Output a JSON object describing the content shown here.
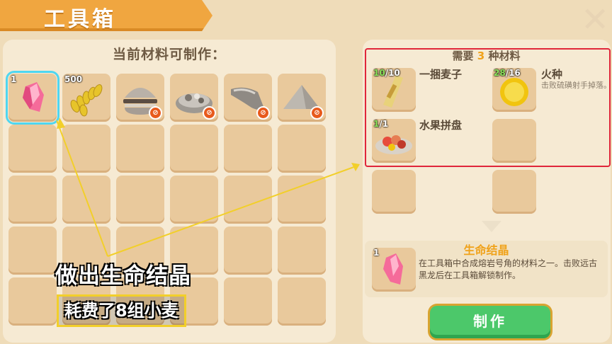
{
  "header": {
    "title": "工具箱"
  },
  "left": {
    "heading": "当前材料可制作：",
    "items": [
      {
        "name": "life-crystal",
        "count": "1",
        "selected": true,
        "locked": false
      },
      {
        "name": "wheat",
        "count": "500",
        "selected": false,
        "locked": false
      },
      {
        "name": "burger",
        "count": "",
        "selected": false,
        "locked": true
      },
      {
        "name": "food-platter",
        "count": "",
        "selected": false,
        "locked": true
      },
      {
        "name": "horn",
        "count": "",
        "selected": false,
        "locked": true
      },
      {
        "name": "powder-pile",
        "count": "",
        "selected": false,
        "locked": true
      }
    ]
  },
  "recipe": {
    "heading_prefix": "需要",
    "heading_count": "3",
    "heading_suffix": "种材料",
    "materials": [
      {
        "name": "一捆麦子",
        "have": "10",
        "need": "/10",
        "desc": ""
      },
      {
        "name": "火种",
        "have": "28",
        "need": "/16",
        "desc": "击败硫磺射手掉落。"
      },
      {
        "name": "水果拼盘",
        "have": "1",
        "need": "/1",
        "desc": ""
      }
    ]
  },
  "result": {
    "title": "生命结晶",
    "count": "1",
    "desc": "在工具箱中合成熔岩号角的材料之一。击败远古黑龙后在工具箱解锁制作。"
  },
  "make_button": "制作",
  "overlay": {
    "caption_main": "做出生命结晶",
    "caption_sub": "耗费了8组小麦"
  },
  "colors": {
    "accent": "#f0a21a",
    "highlight": "#e0263a",
    "button": "#4cc86a",
    "annotation": "#f2cf2a"
  }
}
